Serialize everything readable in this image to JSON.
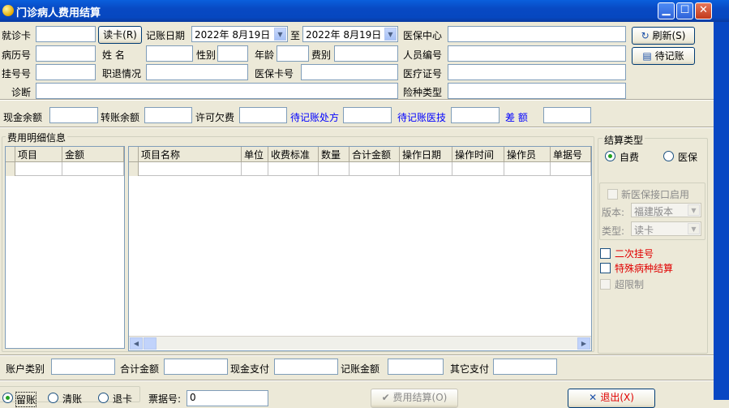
{
  "window": {
    "title": "门诊病人费用结算"
  },
  "row1": {
    "card_label": "就诊卡",
    "card_value": "",
    "read_card_button": "读卡(R)",
    "date_label": "记账日期",
    "date_from": "2022年  8月19日",
    "to_label": "至",
    "date_to": "2022年  8月19日",
    "insurance_center_label": "医保中心",
    "insurance_center_value": ""
  },
  "row2": {
    "record_no_label": "病历号",
    "name_label": "姓    名",
    "gender_label": "性别",
    "age_label": "年龄",
    "fee_type_label": "费别",
    "personnel_no_label": "人员编号"
  },
  "row3": {
    "reg_no_label": "挂号号",
    "retire_label": "职退情况",
    "insurance_card_label": "医保卡号",
    "medical_cert_label": "医疗证号"
  },
  "row4": {
    "diagnosis_label": "诊断",
    "insurance_type_label": "险种类型"
  },
  "side_buttons": {
    "refresh": "刷新(S)",
    "pending": "待记账"
  },
  "balances": {
    "cash_balance": "现金余额",
    "transfer_balance": "转账余额",
    "allowed_arrears": "许可欠费",
    "pending_prescription": "待记账处方",
    "pending_tech": "待记账医技",
    "difference": "差    额"
  },
  "detail": {
    "group_title": "费用明细信息",
    "left_columns": [
      "项目",
      "金额"
    ],
    "right_columns": [
      "项目名称",
      "单位",
      "收费标准",
      "数量",
      "合计金额",
      "操作日期",
      "操作时间",
      "操作员",
      "单据号"
    ]
  },
  "settle": {
    "group_title": "结算类型",
    "self_pay": "自费",
    "insurance": "医保",
    "self_pay_selected": true,
    "new_interface_label": "新医保接口启用",
    "version_label": "版本:",
    "version_value": "福建版本",
    "type_label": "类型:",
    "type_value": "读卡",
    "secondary_reg": "二次挂号",
    "special_disease": "特殊病种结算",
    "over_limit": "超限制"
  },
  "totals": {
    "account_type": "账户类别",
    "total_amount": "合计金额",
    "cash_paid": "现金支付",
    "charged_amount": "记账金额",
    "other_paid": "其它支付"
  },
  "bottom": {
    "opt1": "留账",
    "opt2": "清账",
    "opt3": "退卡",
    "receipt_label": "票据号:",
    "receipt_value": "0",
    "settle_button": "费用结算(O)",
    "exit_button": "退出(X)"
  },
  "colors": {
    "titlebar": "#0a5fdc",
    "window_bg": "#ece9d8",
    "accent_blue": "#0000ff",
    "accent_red": "#e00000"
  }
}
